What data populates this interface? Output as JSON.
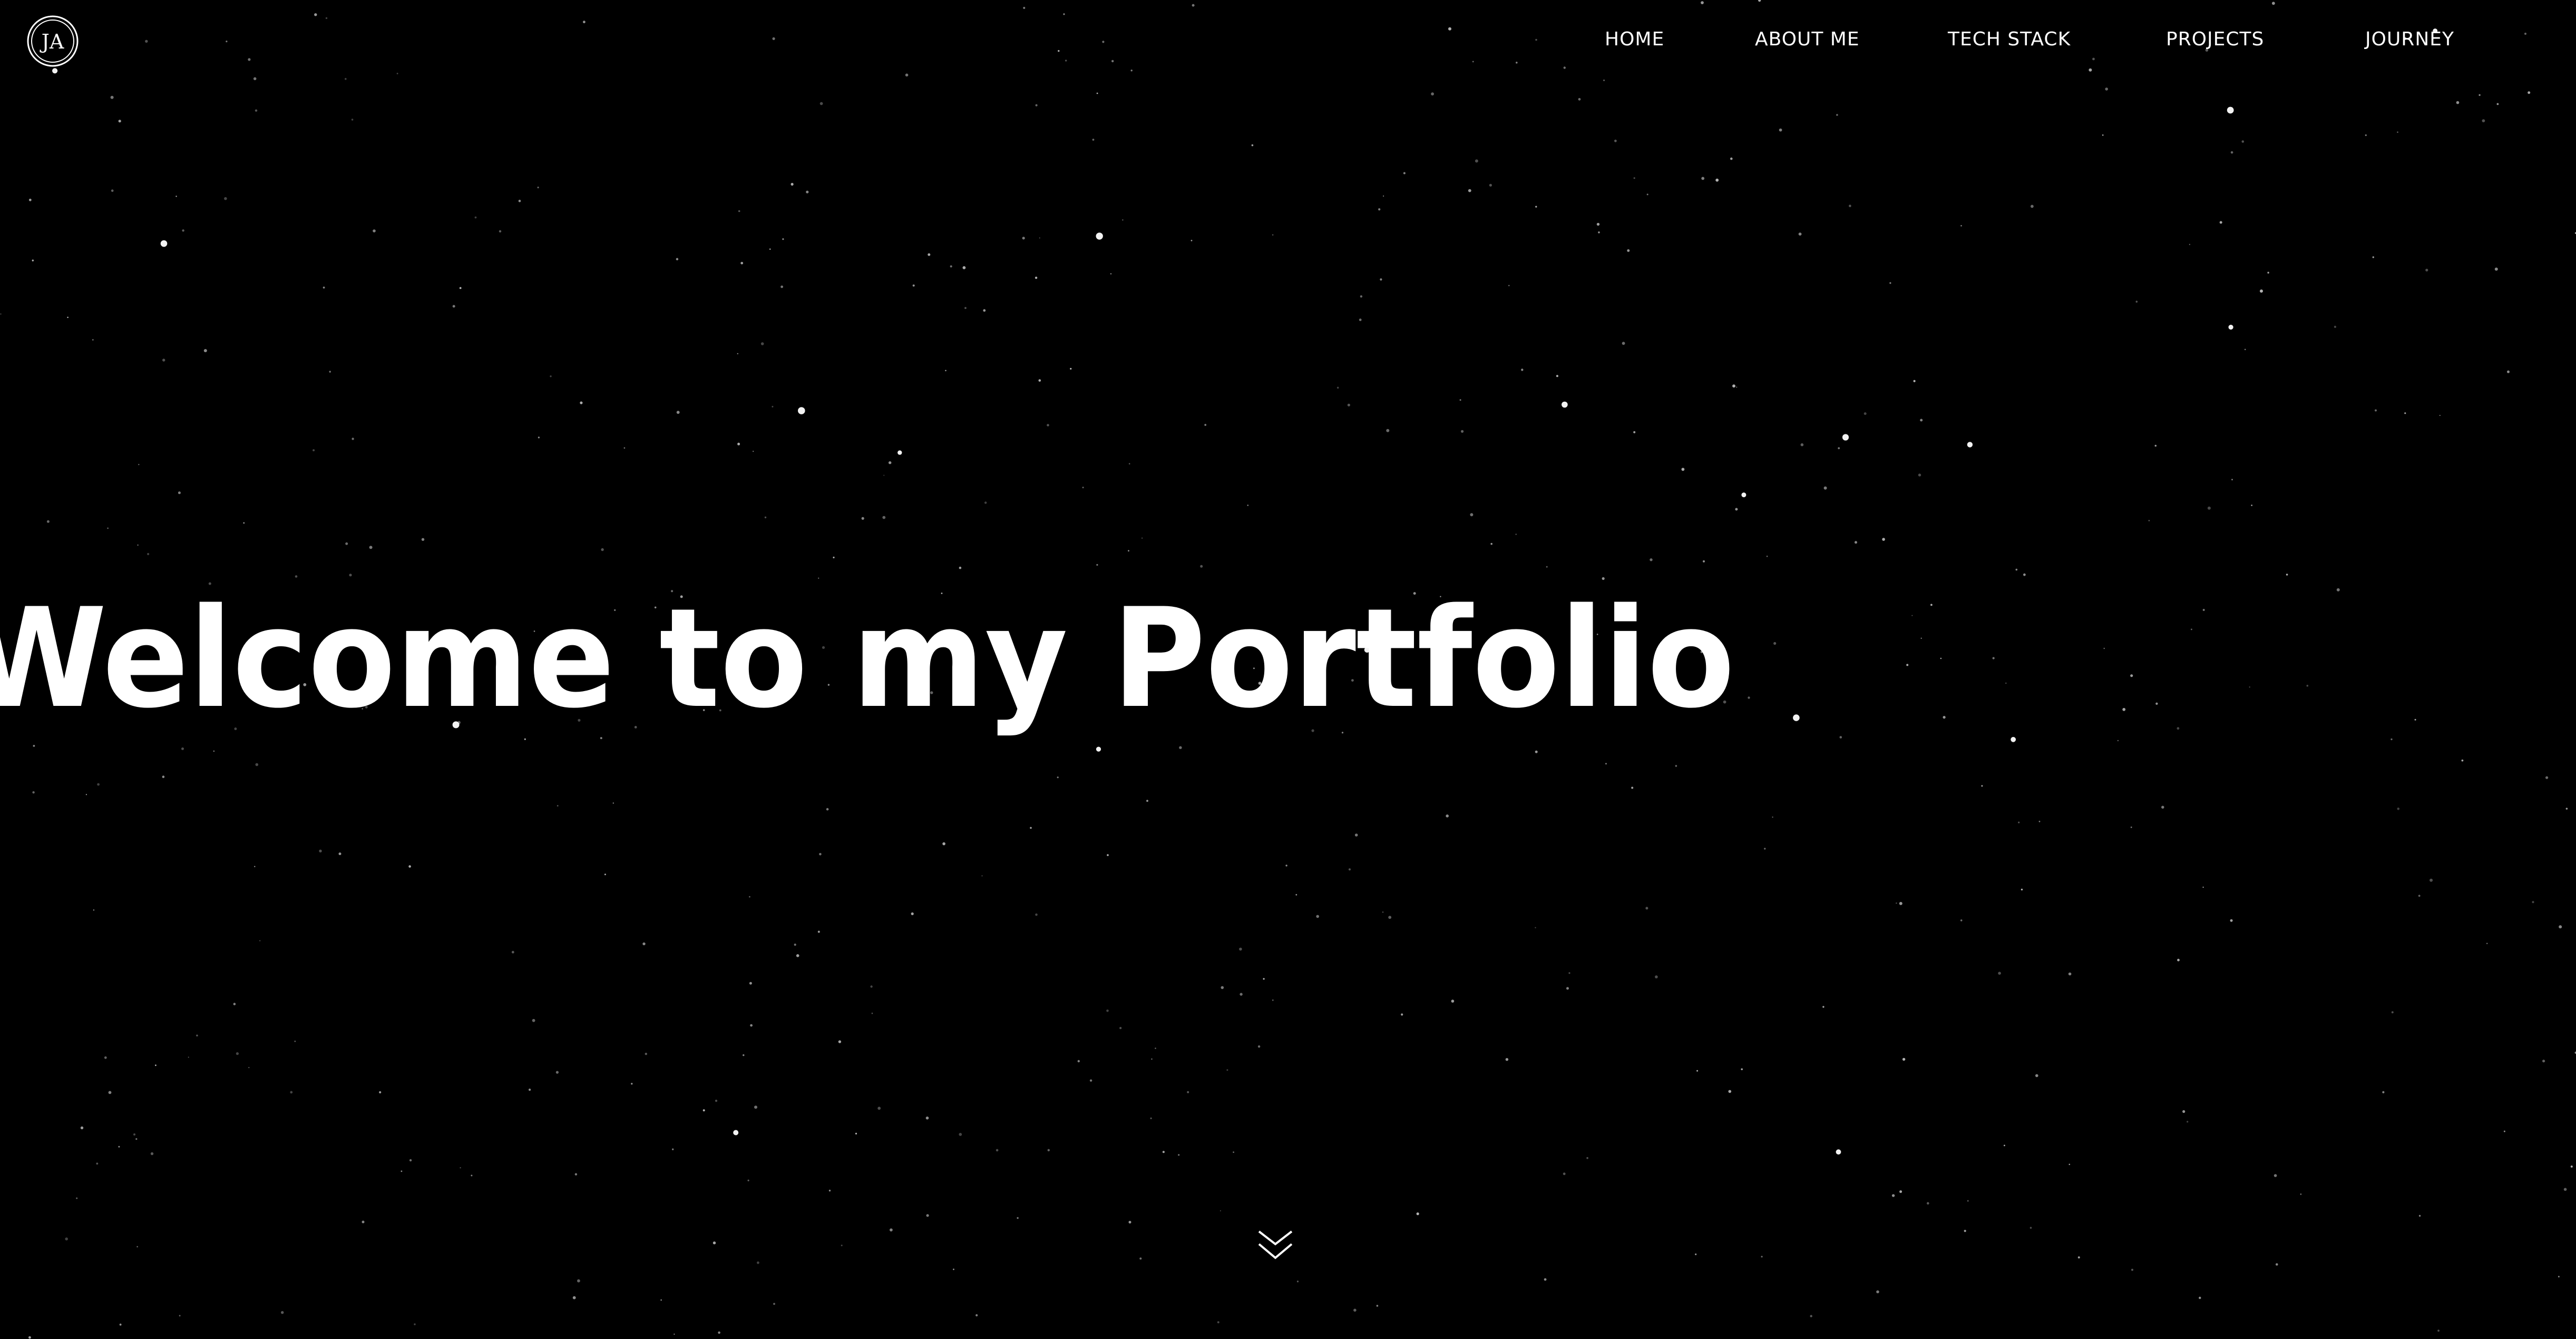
{
  "colors": {
    "background": "#000000",
    "text": "#ffffff",
    "star": "#ffffff"
  },
  "logo": {
    "initials": "JA",
    "icon": "ja-monogram-circle-icon"
  },
  "nav": {
    "items": [
      {
        "label": "HOME"
      },
      {
        "label": "ABOUT ME"
      },
      {
        "label": "TECH STACK"
      },
      {
        "label": "PROJECTS"
      },
      {
        "label": "JOURNEY"
      }
    ]
  },
  "hero": {
    "title": "Welcome to my Portfolio"
  },
  "scroll_indicator": {
    "icon": "double-chevron-down-icon"
  }
}
